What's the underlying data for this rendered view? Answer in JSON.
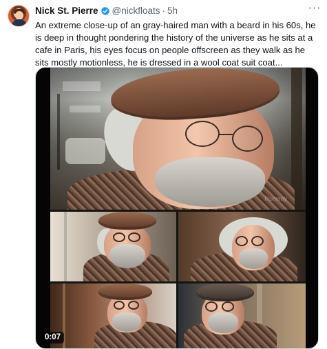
{
  "tweet": {
    "author_name": "Nick St. Pierre",
    "handle": "@nickfloats",
    "separator": "·",
    "time": "5h",
    "more_label": "···",
    "text": "An extreme close-up of an gray-haired man with a beard in his 60s, he is deep in thought pondering the history of the universe as he sits at a cafe in Paris, his eyes focus on people offscreen as they walk as he sits mostly motionless, he is dressed in a wool coat suit coat..."
  },
  "media": {
    "duration": "0:07",
    "watermark": "Runway"
  },
  "colors": {
    "verified": "#1d9bf0",
    "secondary_text": "#536471",
    "primary_text": "#0f1419"
  },
  "icons": {
    "verified": "verified-badge-icon",
    "more": "more-options-icon"
  }
}
